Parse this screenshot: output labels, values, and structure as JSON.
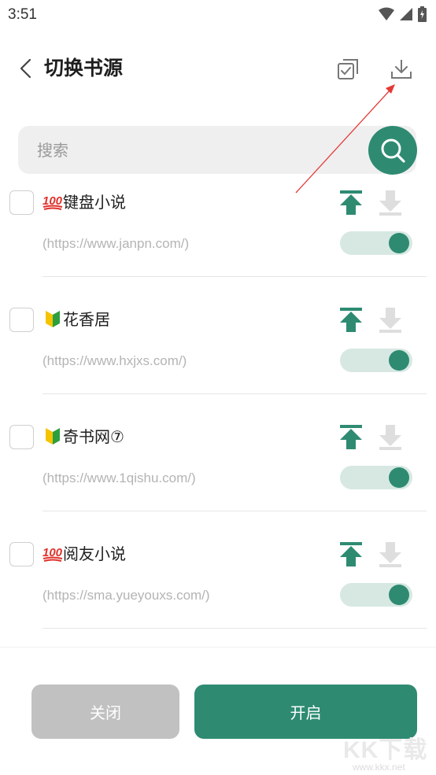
{
  "status_bar": {
    "time": "3:51"
  },
  "app_bar": {
    "title": "切换书源"
  },
  "search": {
    "placeholder": "搜索"
  },
  "sources": [
    {
      "badge": "💯",
      "name": "键盘小说",
      "url": "(https://www.janpn.com/)",
      "enabled": true,
      "checked": false
    },
    {
      "badge": "🔰",
      "name": "花香居",
      "url": "(https://www.hxjxs.com/)",
      "enabled": true,
      "checked": false
    },
    {
      "badge": "🔰",
      "name": "奇书网⑦",
      "url": "(https://www.1qishu.com/)",
      "enabled": true,
      "checked": false
    },
    {
      "badge": "💯",
      "name": "阅友小说",
      "url": "(https://sma.yueyouxs.com/)",
      "enabled": true,
      "checked": false
    }
  ],
  "buttons": {
    "close": "关闭",
    "enable": "开启"
  },
  "watermark": {
    "text": "KK下载",
    "url": "www.kkx.net"
  },
  "colors": {
    "accent": "#2e8b72",
    "toggle_track": "#d7e8e2",
    "disabled_button": "#c1c1c1",
    "annotation": "#e53935"
  },
  "icons": {
    "back": "chevron-left-icon",
    "select_all": "check-square-icon",
    "import": "download-icon",
    "search": "search-icon",
    "top": "arrow-top-icon",
    "bottom": "arrow-bottom-icon"
  }
}
